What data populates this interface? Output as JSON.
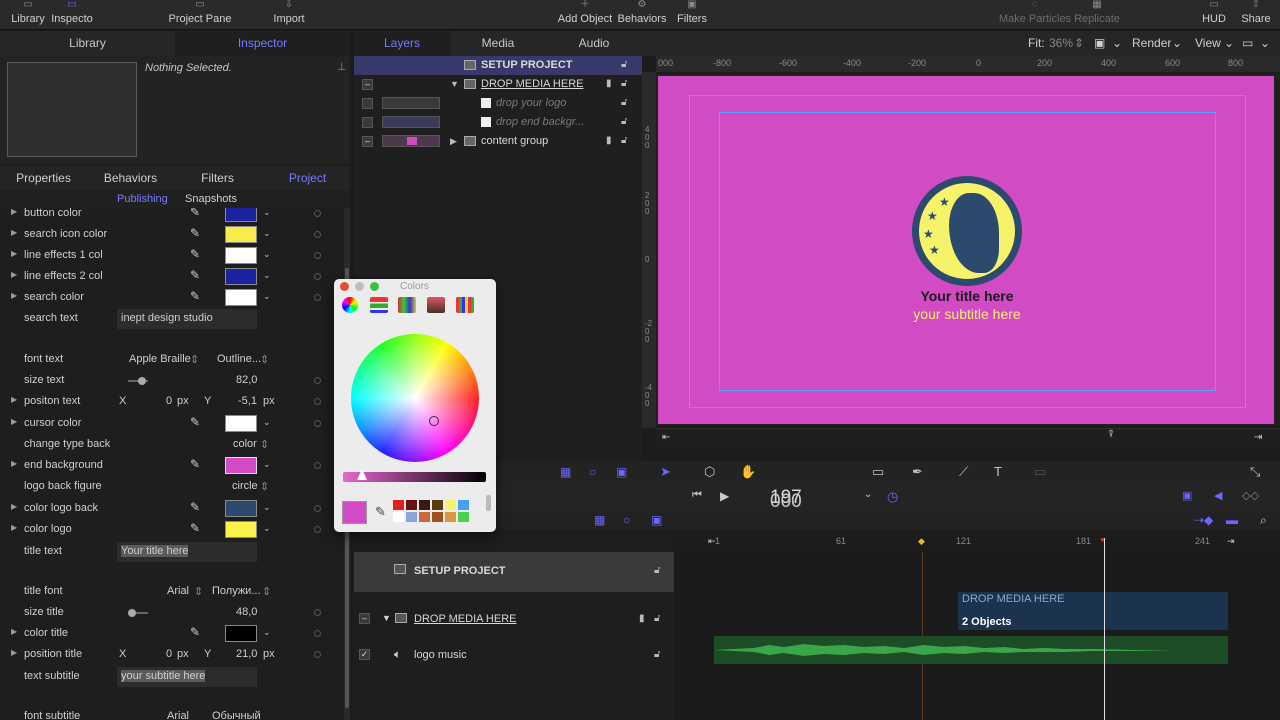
{
  "toolbar": {
    "library": "Library",
    "inspector": "Inspecto",
    "project_pane": "Project Pane",
    "import": "Import",
    "add_object": "Add Object",
    "behaviors": "Behaviors",
    "filters": "Filters",
    "make_particles": "Make Particles",
    "replicate": "Replicate",
    "hud": "HUD",
    "share": "Share"
  },
  "left_tabs": {
    "library": "Library",
    "inspector": "Inspector"
  },
  "inspector": {
    "nothing_selected": "Nothing Selected."
  },
  "sub_tabs": {
    "properties": "Properties",
    "behaviors": "Behaviors",
    "filters": "Filters",
    "project": "Project"
  },
  "project_tabs": {
    "publishing": "Publishing",
    "snapshots": "Snapshots"
  },
  "params": [
    {
      "name": "button color",
      "color": "#1c23a0"
    },
    {
      "name": "search icon color",
      "color": "#f8ec4a"
    },
    {
      "name": "line effects 1 col",
      "color": "#ffffff"
    },
    {
      "name": "line effects 2 col",
      "color": "#1c23a0"
    },
    {
      "name": "search color",
      "color": "#ffffff"
    },
    {
      "name": "search text",
      "value": "inept design studio"
    },
    {
      "name": "font text",
      "font": "Apple Braille",
      "style": "Outline..."
    },
    {
      "name": "size text",
      "value": "82,0"
    },
    {
      "name": "positon text",
      "x_label": "X",
      "x": "0",
      "x_unit": "px",
      "y_label": "Y",
      "y": "-5,1",
      "y_unit": "px"
    },
    {
      "name": "cursor color",
      "color": "#ffffff"
    },
    {
      "name": "change type back",
      "value": "color"
    },
    {
      "name": "end background",
      "color": "#d34bc4"
    },
    {
      "name": "logo back figure",
      "value": "circle"
    },
    {
      "name": "color logo back",
      "color": "#2c4a6e"
    },
    {
      "name": "color logo",
      "color": "#f8f24a"
    },
    {
      "name": "title text",
      "value": "Your title here"
    },
    {
      "name": "title font",
      "font": "Arial",
      "style": "Полужи..."
    },
    {
      "name": "size title",
      "value": "48,0"
    },
    {
      "name": "color title",
      "color": "#000000"
    },
    {
      "name": "position title",
      "x_label": "X",
      "x": "0",
      "x_unit": "px",
      "y_label": "Y",
      "y": "21,0",
      "y_unit": "px"
    },
    {
      "name": "text subtitle",
      "value": "your subtitle here"
    },
    {
      "name": "font subtitle",
      "font": "Arial",
      "style": "Обычный"
    }
  ],
  "colors_panel": {
    "title": "Colors",
    "current_color": "#d34bc4"
  },
  "mid_tabs": {
    "layers": "Layers",
    "media": "Media",
    "audio": "Audio"
  },
  "layers": [
    {
      "name": "SETUP PROJECT"
    },
    {
      "name": "DROP MEDIA HERE"
    },
    {
      "name": "drop your logo"
    },
    {
      "name": "drop end backgr..."
    },
    {
      "name": "content group"
    }
  ],
  "canvas_top": {
    "fit_label": "Fit:",
    "fit_value": "36%",
    "render": "Render",
    "view": "View"
  },
  "ruler": [
    "000",
    "-800",
    "-600",
    "-400",
    "-200",
    "0",
    "200",
    "400",
    "600",
    "800"
  ],
  "ruler_v": [
    "400",
    "200",
    "0",
    "-200",
    "-400"
  ],
  "canvas": {
    "title": "Your title here",
    "subtitle": "your subtitle here",
    "background": "#d34bc4"
  },
  "timecode": {
    "dim": "000",
    "bright": "197"
  },
  "timeline_ruler": [
    "1",
    "61",
    "121",
    "181",
    "241"
  ],
  "tracks": [
    {
      "name": "SETUP PROJECT"
    },
    {
      "name": "DROP MEDIA HERE"
    },
    {
      "name": "logo music"
    }
  ],
  "clips": {
    "drop_media": "DROP MEDIA HERE",
    "objects": "2 Objects"
  }
}
